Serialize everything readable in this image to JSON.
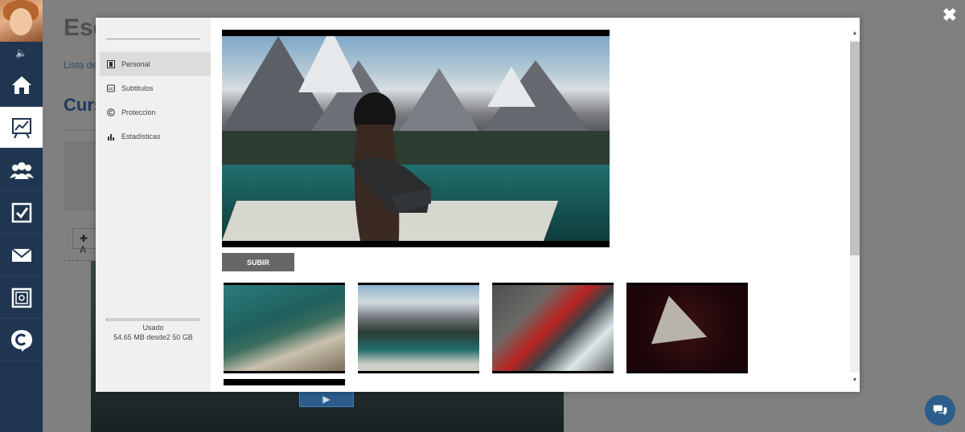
{
  "background_page": {
    "title": "Esc",
    "link": "Lista de c",
    "heading": "Curs",
    "add_button": "✚ A"
  },
  "app_sidebar": {
    "items": [
      {
        "icon": "home-icon"
      },
      {
        "icon": "chart-icon",
        "active": true
      },
      {
        "icon": "users-icon"
      },
      {
        "icon": "checkbox-icon"
      },
      {
        "icon": "mail-icon"
      },
      {
        "icon": "safe-icon"
      },
      {
        "icon": "brand-c-icon"
      }
    ]
  },
  "modal": {
    "nav": [
      {
        "label": "Personal",
        "icon": "film-icon",
        "active": true
      },
      {
        "label": "Subtitulos",
        "icon": "cc-icon"
      },
      {
        "label": "Proteccion",
        "icon": "copyright-icon"
      },
      {
        "label": "Estadísticas",
        "icon": "bar-chart-icon"
      }
    ],
    "usage": {
      "label": "Usado",
      "text": "54.65 MB desde2 50 GB",
      "fraction": 0.001
    },
    "upload_label": "SUBIR",
    "thumbnails": [
      {
        "scene": "feet-boat-water"
      },
      {
        "scene": "woman-boat-mountains"
      },
      {
        "scene": "hiker-red-jacket"
      },
      {
        "scene": "dark-triangle-object"
      }
    ]
  },
  "colors": {
    "sidebar": "#1f3550",
    "accent": "#2b5d8d",
    "upload_button": "#676767"
  }
}
